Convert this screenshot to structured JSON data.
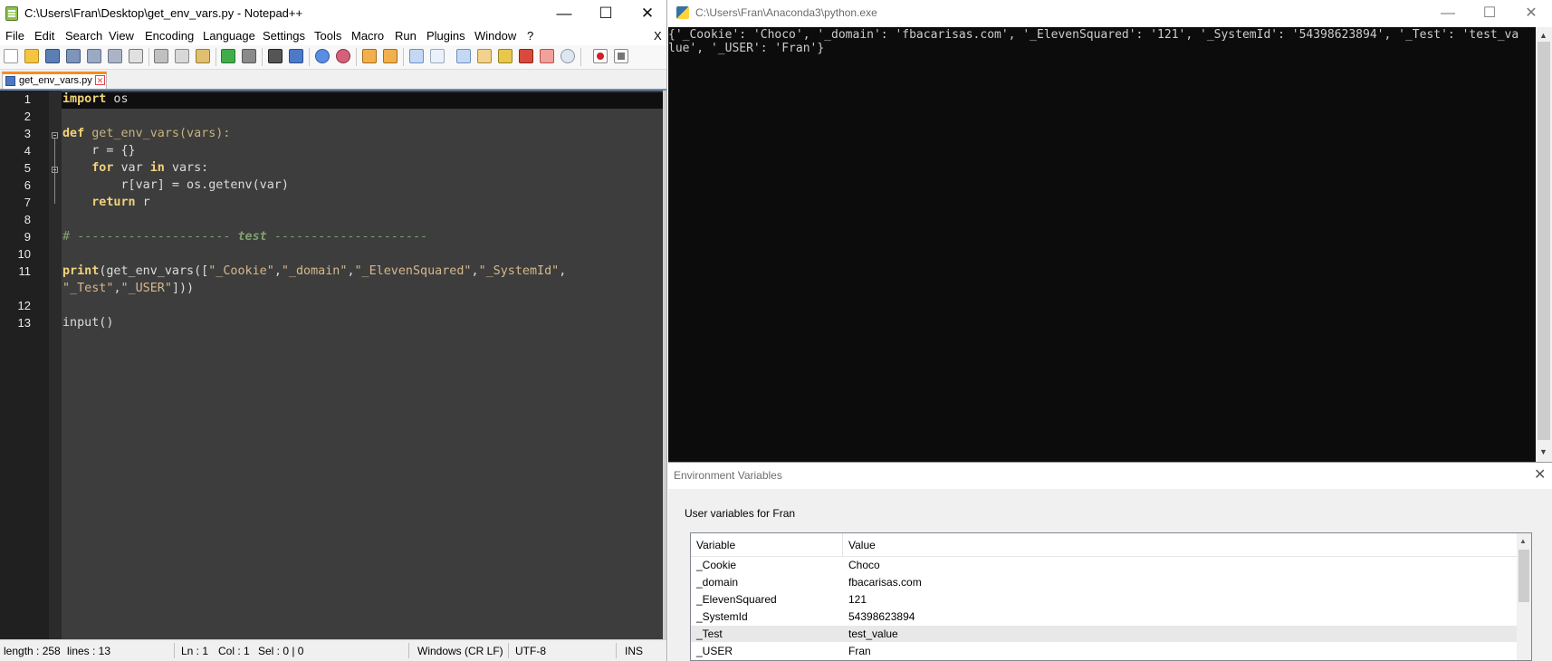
{
  "notepad": {
    "title": "C:\\Users\\Fran\\Desktop\\get_env_vars.py - Notepad++",
    "menu": [
      "File",
      "Edit",
      "Search",
      "View",
      "Encoding",
      "Language",
      "Settings",
      "Tools",
      "Macro",
      "Run",
      "Plugins",
      "Window",
      "?"
    ],
    "menu_close": "X",
    "tab_label": "get_env_vars.py",
    "line_numbers": [
      "1",
      "2",
      "3",
      "4",
      "5",
      "6",
      "7",
      "8",
      "9",
      "10",
      "11",
      "12",
      "13"
    ],
    "status": {
      "length": "length : 258",
      "lines": "lines : 13",
      "ln": "Ln : 1",
      "col": "Col : 1",
      "sel": "Sel : 0 | 0",
      "eol": "Windows (CR LF)",
      "encoding": "UTF-8",
      "mode": "INS"
    }
  },
  "code": {
    "l1_kw": "import",
    "l1_rest": " os",
    "l3_kw": "def",
    "l3_rest": " get_env_vars(vars):",
    "l4": "    r = {}",
    "l5_indent": "    ",
    "l5_for": "for",
    "l5_var": " var ",
    "l5_in": "in",
    "l5_rest": " vars:",
    "l6": "        r[var] = os.getenv(var)",
    "l7_indent": "    ",
    "l7_kw": "return",
    "l7_rest": " r",
    "l9_a": "# --------------------- ",
    "l9_b": "test",
    "l9_c": " ---------------------",
    "l11_print": "print",
    "l11_a": "(get_env_vars([",
    "l11_s1": "\"_Cookie\"",
    "l11_c1": ",",
    "l11_s2": "\"_domain\"",
    "l11_c2": ",",
    "l11_s3": "\"_ElevenSquared\"",
    "l11_c3": ",",
    "l11_s4": "\"_SystemId\"",
    "l11_c4": ",",
    "l11b_s5": "\"_Test\"",
    "l11b_c5": ",",
    "l11b_s6": "\"_USER\"",
    "l11b_end": "]))",
    "l13": "input()"
  },
  "console": {
    "title": "C:\\Users\\Fran\\Anaconda3\\python.exe",
    "line1": "{'_Cookie': 'Choco', '_domain': 'fbacarisas.com', '_ElevenSquared': '121', '_SystemId': '54398623894', '_Test': 'test_va",
    "line2": "lue', '_USER': 'Fran'}"
  },
  "env_dialog": {
    "title": "Environment Variables",
    "group_label": "User variables for Fran",
    "columns": [
      "Variable",
      "Value"
    ],
    "rows": [
      [
        "_Cookie",
        "Choco"
      ],
      [
        "_domain",
        "fbacarisas.com"
      ],
      [
        "_ElevenSquared",
        "121"
      ],
      [
        "_SystemId",
        "54398623894"
      ],
      [
        "_Test",
        "test_value"
      ],
      [
        "_USER",
        "Fran"
      ]
    ],
    "selected_row": 4
  }
}
